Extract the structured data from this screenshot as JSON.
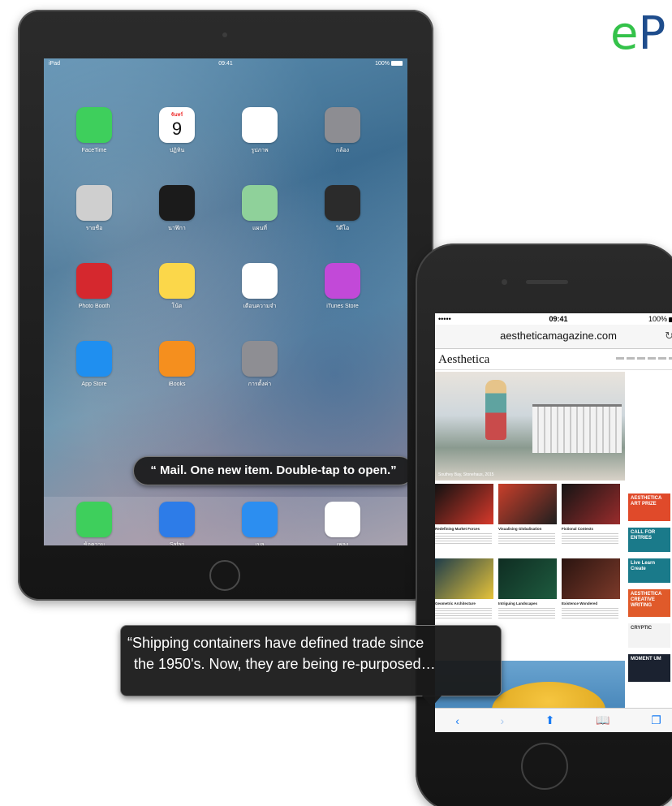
{
  "brand": {
    "text_a": "e",
    "text_b": "P"
  },
  "ipad": {
    "status": {
      "carrier": "iPad",
      "time": "09:41",
      "battery": "100%"
    },
    "apps": [
      {
        "name": "FaceTime",
        "icon": "facetime-icon",
        "color": "#3ecf5c"
      },
      {
        "name": "ปฏิทิน",
        "icon": "calendar-icon",
        "color": "#ffffff",
        "glyph": "9",
        "day": "จันทร์"
      },
      {
        "name": "รูปภาพ",
        "icon": "photos-icon",
        "color": "#ffffff"
      },
      {
        "name": "กล้อง",
        "icon": "camera-icon",
        "color": "#8d8d92"
      },
      {
        "name": "รายชื่อ",
        "icon": "contacts-icon",
        "color": "#cfcfcf"
      },
      {
        "name": "นาฬิกา",
        "icon": "clock-icon",
        "color": "#1b1b1b"
      },
      {
        "name": "แผนที่",
        "icon": "maps-icon",
        "color": "#8fd19a"
      },
      {
        "name": "วิดีโอ",
        "icon": "videos-icon",
        "color": "#2b2b2b"
      },
      {
        "name": "Photo Booth",
        "icon": "photo-booth-icon",
        "color": "#d5282e"
      },
      {
        "name": "โน้ต",
        "icon": "notes-icon",
        "color": "#fbd74a"
      },
      {
        "name": "เตือนความจำ",
        "icon": "reminders-icon",
        "color": "#ffffff"
      },
      {
        "name": "iTunes Store",
        "icon": "itunes-store-icon",
        "color": "#c249d8"
      },
      {
        "name": "App Store",
        "icon": "app-store-icon",
        "color": "#1f8ff0"
      },
      {
        "name": "iBooks",
        "icon": "ibooks-icon",
        "color": "#f58f1e"
      },
      {
        "name": "การตั้งค่า",
        "icon": "settings-icon",
        "color": "#8e8e93"
      }
    ],
    "dock": [
      {
        "name": "ข้อความ",
        "icon": "messages-icon",
        "color": "#3ecf5c"
      },
      {
        "name": "Safari",
        "icon": "safari-icon",
        "color": "#2d7ce8"
      },
      {
        "name": "เมล",
        "icon": "mail-icon",
        "color": "#2c8ef0"
      },
      {
        "name": "เพลง",
        "icon": "music-icon",
        "color": "#ffffff"
      }
    ],
    "voiceover": "“ Mail. One new item. Double-tap to open.”"
  },
  "iphone": {
    "status": {
      "carrier": "•••••",
      "time": "09:41",
      "battery": "100%"
    },
    "url": "aestheticamagazine.com",
    "site": {
      "logo": "Aesthetica",
      "hero_caption": "Southey Bay, Stonehaus, 2015",
      "grid": [
        {
          "title": "Redefining Market Forces"
        },
        {
          "title": "Visualising Globalisation"
        },
        {
          "title": "Fictional Contexts"
        },
        {
          "title": "Geometric Architecture"
        },
        {
          "title": "Intriguing Landscapes"
        },
        {
          "title": "Existence Wondered"
        }
      ],
      "side": [
        "AESTHETICA ART PRIZE",
        "CALL FOR ENTRIES",
        "Live Learn Create",
        "AESTHETICA CREATIVE WRITING",
        "CRYPTIC",
        "MOMENT UM"
      ]
    },
    "toolbar": {
      "back": "‹",
      "forward": "›",
      "share": "⬆",
      "bookmarks": "📖",
      "tabs": "❐"
    }
  },
  "speech": {
    "line1": "“Shipping containers have defined trade since",
    "line2": "the 1950's. Now, they are being re-purposed…"
  }
}
